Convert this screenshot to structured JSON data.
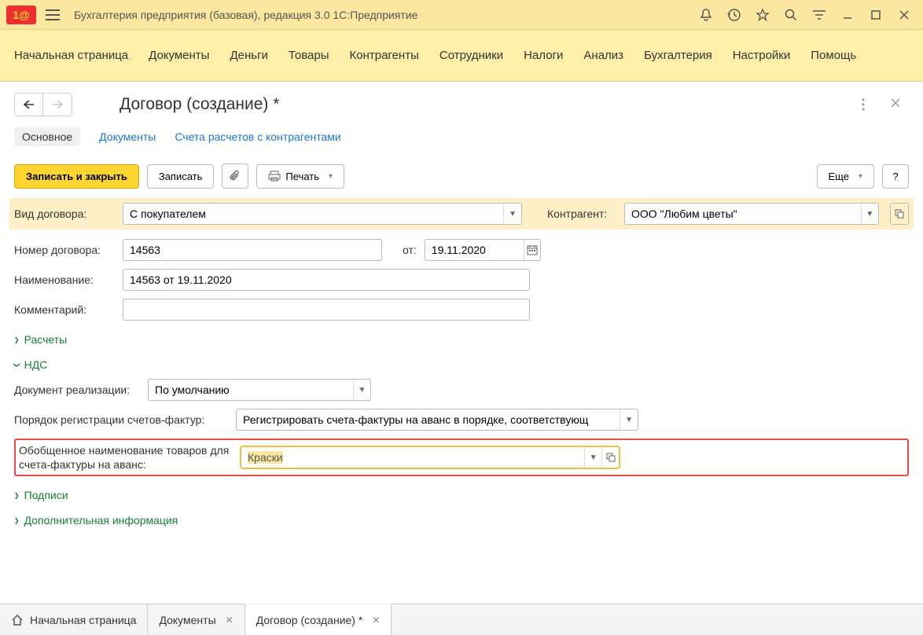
{
  "app": {
    "title": "Бухгалтерия предприятия (базовая), редакция 3.0 1С:Предприятие",
    "logo": "1@"
  },
  "menu": {
    "items": [
      "Начальная страница",
      "Документы",
      "Деньги",
      "Товары",
      "Контрагенты",
      "Сотрудники",
      "Налоги",
      "Анализ",
      "Бухгалтерия",
      "Настройки",
      "Помощь"
    ]
  },
  "page": {
    "title": "Договор (создание) *",
    "tabs": {
      "active": "Основное",
      "links": [
        "Документы",
        "Счета расчетов с контрагентами"
      ]
    }
  },
  "toolbar": {
    "save_close": "Записать и закрыть",
    "save": "Записать",
    "print": "Печать",
    "more": "Еще",
    "help": "?"
  },
  "form": {
    "contract_type": {
      "label": "Вид договора:",
      "value": "С покупателем"
    },
    "counterparty": {
      "label": "Контрагент:",
      "value": "ООО \"Любим цветы\""
    },
    "number": {
      "label": "Номер договора:",
      "value": "14563",
      "from_label": "от:",
      "date": "19.11.2020"
    },
    "name": {
      "label": "Наименование:",
      "value": "14563 от 19.11.2020"
    },
    "comment": {
      "label": "Комментарий:",
      "value": ""
    },
    "groups": {
      "payments": "Расчеты",
      "vat": "НДС",
      "signatures": "Подписи",
      "additional": "Дополнительная информация"
    },
    "realization_doc": {
      "label": "Документ реализации:",
      "value": "По умолчанию"
    },
    "invoice_order": {
      "label": "Порядок регистрации счетов-фактур:",
      "value": "Регистрировать счета-фактуры на аванс в порядке, соответствующ"
    },
    "generic_name": {
      "label": "Обобщенное наименование товаров для счета-фактуры на аванс:",
      "value": "Краски"
    }
  },
  "bottom_tabs": {
    "home": "Начальная страница",
    "tabs": [
      "Документы",
      "Договор (создание) *"
    ]
  }
}
